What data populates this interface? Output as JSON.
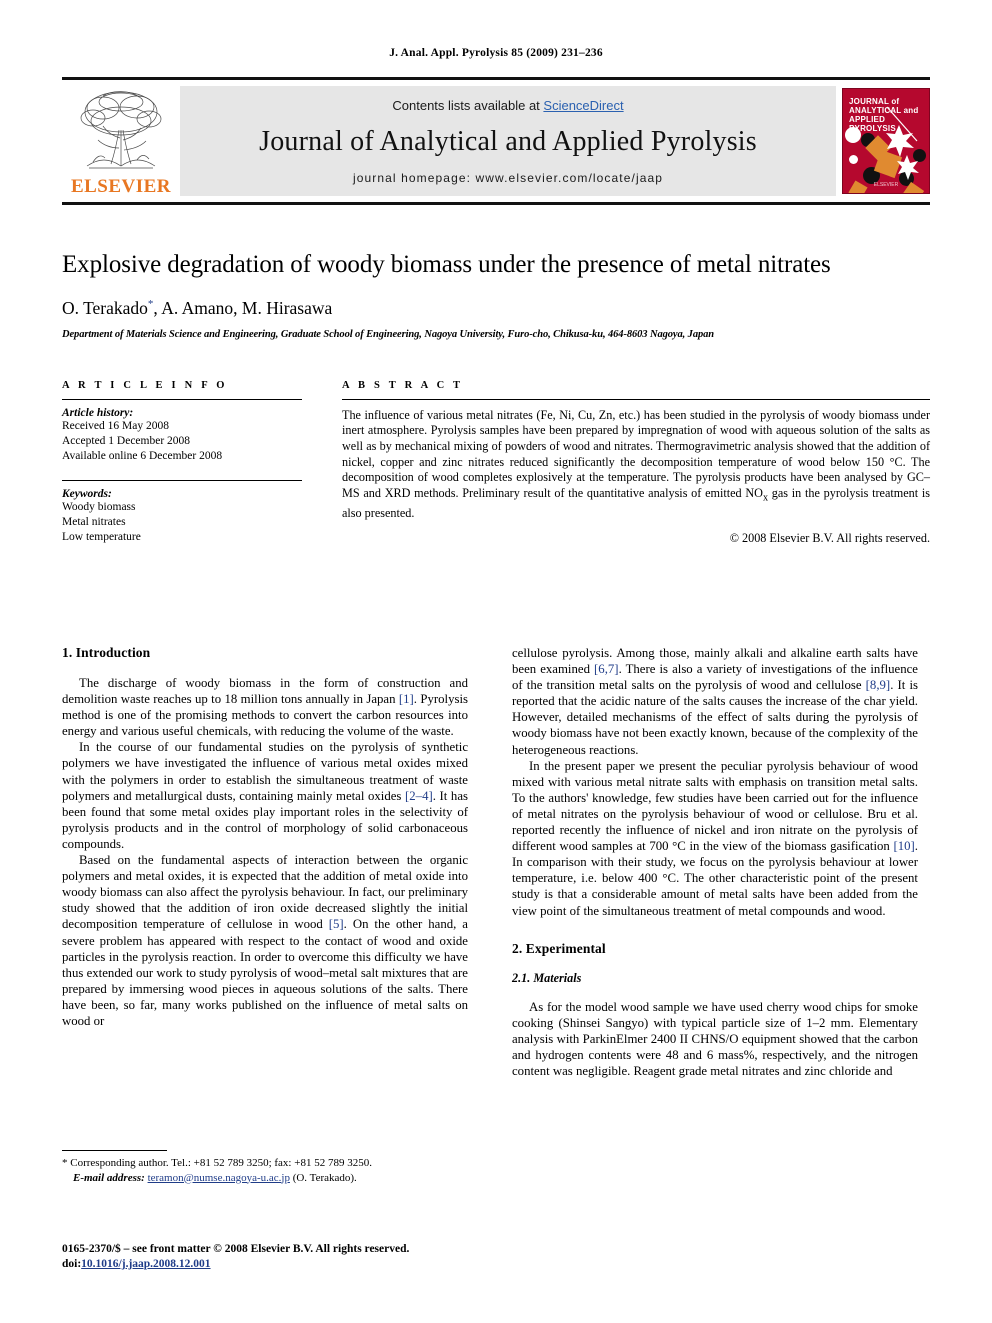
{
  "running_head": "J. Anal. Appl. Pyrolysis 85 (2009) 231–236",
  "header": {
    "contents_prefix": "Contents lists available at ",
    "sciencedirect": "ScienceDirect",
    "journal_title": "Journal of Analytical and Applied Pyrolysis",
    "homepage": "journal homepage: www.elsevier.com/locate/jaap",
    "publisher_wordmark": "ELSEVIER",
    "cover": {
      "line1": "JOURNAL of",
      "line2": "ANALYTICAL and",
      "line3": "APPLIED PYROLYSIS",
      "footer": "ELSEVIER",
      "background_color": "#B5082E",
      "accent_color": "#E08A30"
    }
  },
  "article": {
    "title": "Explosive degradation of woody biomass under the presence of metal nitrates",
    "authors": "O. Terakado , A. Amano, M. Hirasawa",
    "corresponding_marker": "*",
    "affiliation": "Department of Materials Science and Engineering, Graduate School of Engineering, Nagoya University, Furo-cho, Chikusa-ku, 464-8603 Nagoya, Japan"
  },
  "article_info": {
    "heading": "A R T I C L E   I N F O",
    "history_label": "Article history:",
    "history": [
      "Received 16 May 2008",
      "Accepted 1 December 2008",
      "Available online 6 December 2008"
    ],
    "keywords_label": "Keywords:",
    "keywords": [
      "Woody biomass",
      "Metal nitrates",
      "Low temperature"
    ]
  },
  "abstract": {
    "heading": "A B S T R A C T",
    "text": "The influence of various metal nitrates (Fe, Ni, Cu, Zn, etc.) has been studied in the pyrolysis of woody biomass under inert atmosphere. Pyrolysis samples have been prepared by impregnation of wood with aqueous solution of the salts as well as by mechanical mixing of powders of wood and nitrates. Thermogravimetric analysis showed that the addition of nickel, copper and zinc nitrates reduced significantly the decomposition temperature of wood below 150 °C. The decomposition of wood completes explosively at the temperature. The pyrolysis products have been analysed by GC–MS and XRD methods. Preliminary result of the quantitative analysis of emitted NO",
    "text_sub": "x",
    "text_tail": " gas in the pyrolysis treatment is also presented.",
    "copyright": "© 2008 Elsevier B.V. All rights reserved."
  },
  "sections": {
    "introduction_heading": "1. Introduction",
    "experimental_heading": "2. Experimental",
    "materials_heading": "2.1. Materials"
  },
  "left_column": {
    "p1_a": "The discharge of woody biomass in the form of construction and demolition waste reaches up to 18 million tons annually in Japan ",
    "p1_ref": "[1]",
    "p1_b": ". Pyrolysis method is one of the promising methods to convert the carbon resources into energy and various useful chemicals, with reducing the volume of the waste.",
    "p2_a": "In the course of our fundamental studies on the pyrolysis of synthetic polymers we have investigated the influence of various metal oxides mixed with the polymers in order to establish the simultaneous treatment of waste polymers and metallurgical dusts, containing mainly metal oxides ",
    "p2_ref": "[2–4]",
    "p2_b": ". It has been found that some metal oxides play important roles in the selectivity of pyrolysis products and in the control of morphology of solid carbonaceous compounds.",
    "p3_a": "Based on the fundamental aspects of interaction between the organic polymers and metal oxides, it is expected that the addition of metal oxide into woody biomass can also affect the pyrolysis behaviour. In fact, our preliminary study showed that the addition of iron oxide decreased slightly the initial decomposition temperature of cellulose in wood ",
    "p3_ref": "[5]",
    "p3_b": ". On the other hand, a severe problem has appeared with respect to the contact of wood and oxide particles in the pyrolysis reaction. In order to overcome this difficulty we have thus extended our work to study pyrolysis of wood–metal salt mixtures that are prepared by immersing wood pieces in aqueous solutions of the salts. There have been, so far, many works published on the influence of metal salts on wood or"
  },
  "right_column": {
    "p1_a": "cellulose pyrolysis. Among those, mainly alkali and alkaline earth salts have been examined ",
    "p1_ref1": "[6,7]",
    "p1_b": ". There is also a variety of investigations of the influence of the transition metal salts on the pyrolysis of wood and cellulose ",
    "p1_ref2": "[8,9]",
    "p1_c": ". It is reported that the acidic nature of the salts causes the increase of the char yield. However, detailed mechanisms of the effect of salts during the pyrolysis of woody biomass have not been exactly known, because of the complexity of the heterogeneous reactions.",
    "p2_a": "In the present paper we present the peculiar pyrolysis behaviour of wood mixed with various metal nitrate salts with emphasis on transition metal salts. To the authors' knowledge, few studies have been carried out for the influence of metal nitrates on the pyrolysis behaviour of wood or cellulose. Bru et al. reported recently the influence of nickel and iron nitrate on the pyrolysis of different wood samples at 700 °C in the view of the biomass gasification ",
    "p2_ref": "[10]",
    "p2_b": ". In comparison with their study, we focus on the pyrolysis behaviour at lower temperature, i.e. below 400 °C. The other characteristic point of the present study is that a considerable amount of metal salts have been added from the view point of the simultaneous treatment of metal compounds and wood.",
    "p3": "As for the model wood sample we have used cherry wood chips for smoke cooking (Shinsei Sangyo) with typical particle size of 1–2 mm. Elementary analysis with ParkinElmer 2400 II CHNS/O equipment showed that the carbon and hydrogen contents were 48 and 6 mass%, respectively, and the nitrogen content was negligible. Reagent grade metal nitrates and zinc chloride and"
  },
  "footnote": {
    "marker": "*",
    "line1": "Corresponding author. Tel.: +81 52 789 3250; fax: +81 52 789 3250.",
    "email_label": "E-mail address:",
    "email": "teramon@numse.nagoya-u.ac.jp",
    "email_owner": "(O. Terakado)."
  },
  "page_footer": {
    "issn_line": "0165-2370/$ – see front matter © 2008 Elsevier B.V. All rights reserved.",
    "doi_label": "doi:",
    "doi": "10.1016/j.jaap.2008.12.001"
  }
}
